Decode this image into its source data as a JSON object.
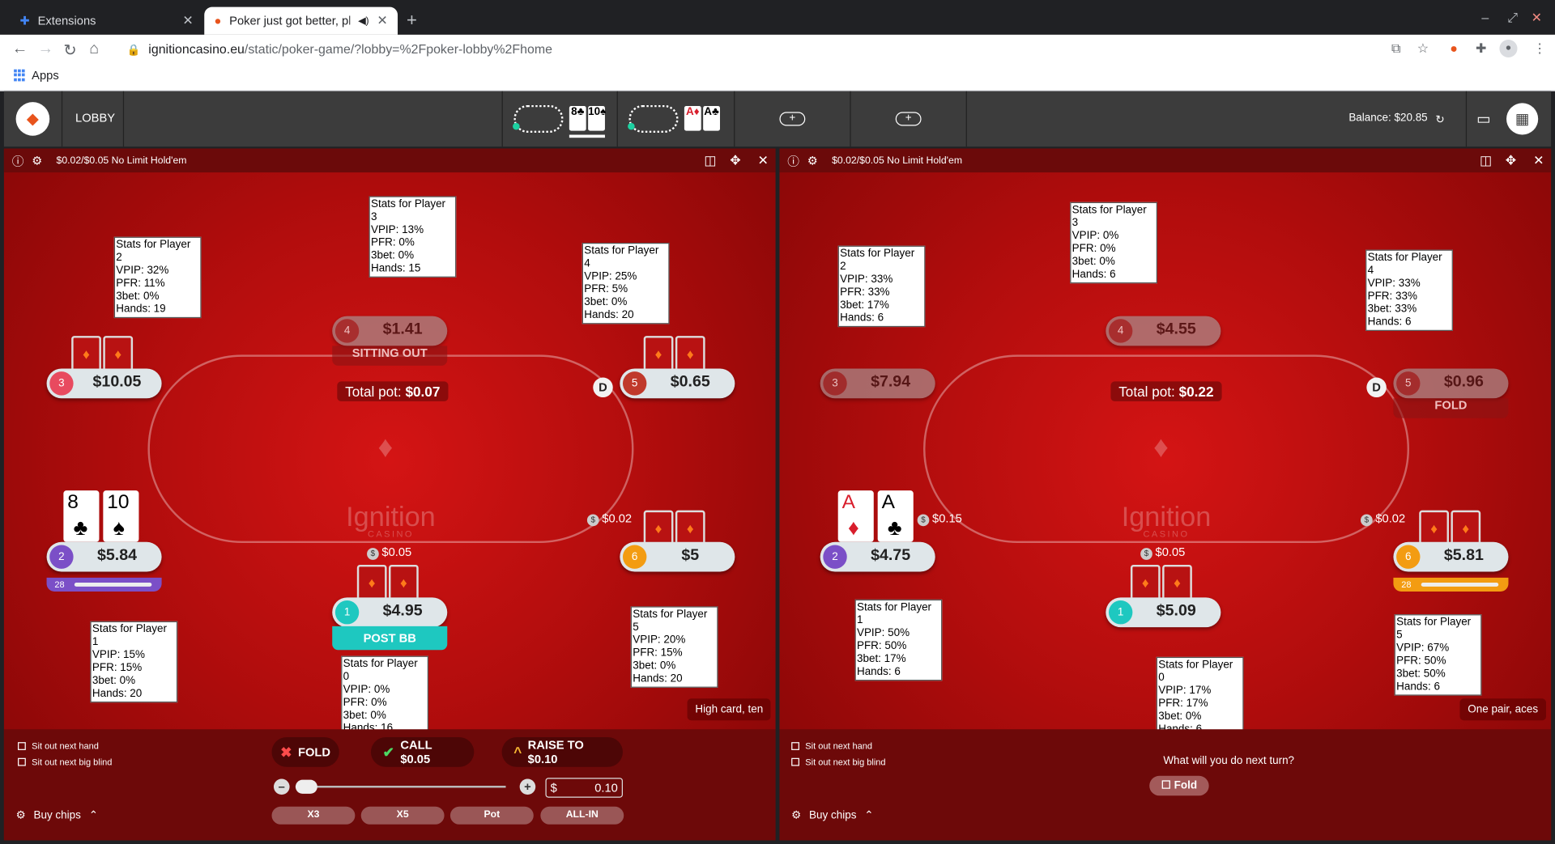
{
  "browser": {
    "tabs": [
      {
        "title": "Extensions",
        "icon": "puzzle-icon"
      },
      {
        "title": "Poker just got better, pla",
        "icon": "ignition-favicon"
      }
    ],
    "url_host": "ignitioncasino.eu",
    "url_path": "/static/poker-game/?lobby=%2Fpoker-lobby%2Fhome",
    "bookmarks_label": "Apps"
  },
  "header": {
    "lobby_label": "LOBBY",
    "mini1_cards": [
      "8♣",
      "10♠"
    ],
    "mini2_cards": [
      "A♦",
      "A♣"
    ],
    "balance": "Balance: $20.85"
  },
  "table_left": {
    "title": "$0.02/$0.05 No Limit Hold'em",
    "total_pot_label": "Total pot:",
    "total_pot": "$0.07",
    "seats": [
      {
        "num": "4",
        "amount": "$1.41",
        "state": "SITTING OUT"
      },
      {
        "num": "3",
        "amount": "$10.05"
      },
      {
        "num": "5",
        "amount": "$0.65"
      },
      {
        "num": "2",
        "amount": "$5.84",
        "timer": "28"
      },
      {
        "num": "6",
        "amount": "$5"
      },
      {
        "num": "1",
        "amount": "$4.95",
        "state": "POST BB"
      }
    ],
    "bets": [
      "$0.02",
      "$0.05"
    ],
    "hero_cards": [
      {
        "rank": "8",
        "suit": "♣"
      },
      {
        "rank": "10",
        "suit": "♠"
      }
    ],
    "stats": [
      {
        "title": "Stats for Player 2",
        "vpip": "VPIP: 32%",
        "pfr": "PFR: 11%",
        "bet3": "3bet: 0%",
        "hands": "Hands: 19"
      },
      {
        "title": "Stats for Player 3",
        "vpip": "VPIP: 13%",
        "pfr": "PFR: 0%",
        "bet3": "3bet: 0%",
        "hands": "Hands: 15"
      },
      {
        "title": "Stats for Player 4",
        "vpip": "VPIP: 25%",
        "pfr": "PFR: 5%",
        "bet3": "3bet: 0%",
        "hands": "Hands: 20"
      },
      {
        "title": "Stats for Player 1",
        "vpip": "VPIP: 15%",
        "pfr": "PFR: 15%",
        "bet3": "3bet: 0%",
        "hands": "Hands: 20"
      },
      {
        "title": "Stats for Player 5",
        "vpip": "VPIP: 20%",
        "pfr": "PFR: 15%",
        "bet3": "3bet: 0%",
        "hands": "Hands: 20"
      },
      {
        "title": "Stats for Player 0",
        "vpip": "VPIP: 0%",
        "pfr": "PFR: 0%",
        "bet3": "3bet: 0%",
        "hands": "Hands: 16"
      }
    ],
    "hand_label": "High card, ten",
    "sit_out_next_hand": "Sit out next hand",
    "sit_out_next_bb": "Sit out next big blind",
    "fold": "FOLD",
    "call": "CALL $0.05",
    "raise": "RAISE TO $0.10",
    "bet_currency": "$",
    "bet_value": "0.10",
    "bet_fraction": 0.0,
    "presets": [
      "X3",
      "X5",
      "Pot",
      "ALL-IN"
    ],
    "buy_chips": "Buy chips"
  },
  "table_right": {
    "title": "$0.02/$0.05 No Limit Hold'em",
    "total_pot_label": "Total pot:",
    "total_pot": "$0.22",
    "seats": [
      {
        "num": "4",
        "amount": "$4.55"
      },
      {
        "num": "3",
        "amount": "$7.94"
      },
      {
        "num": "5",
        "amount": "$0.96",
        "state": "FOLD"
      },
      {
        "num": "2",
        "amount": "$4.75"
      },
      {
        "num": "6",
        "amount": "$5.81",
        "timer": "28"
      },
      {
        "num": "1",
        "amount": "$5.09"
      }
    ],
    "bets": [
      "$0.15",
      "$0.02",
      "$0.05"
    ],
    "hero_cards": [
      {
        "rank": "A",
        "suit": "♦"
      },
      {
        "rank": "A",
        "suit": "♣"
      }
    ],
    "stats": [
      {
        "title": "Stats for Player 2",
        "vpip": "VPIP: 33%",
        "pfr": "PFR: 33%",
        "bet3": "3bet: 17%",
        "hands": "Hands: 6"
      },
      {
        "title": "Stats for Player 3",
        "vpip": "VPIP: 0%",
        "pfr": "PFR: 0%",
        "bet3": "3bet: 0%",
        "hands": "Hands: 6"
      },
      {
        "title": "Stats for Player 4",
        "vpip": "VPIP: 33%",
        "pfr": "PFR: 33%",
        "bet3": "3bet: 33%",
        "hands": "Hands: 6"
      },
      {
        "title": "Stats for Player 1",
        "vpip": "VPIP: 50%",
        "pfr": "PFR: 50%",
        "bet3": "3bet: 17%",
        "hands": "Hands: 6"
      },
      {
        "title": "Stats for Player 5",
        "vpip": "VPIP: 67%",
        "pfr": "PFR: 50%",
        "bet3": "3bet: 50%",
        "hands": "Hands: 6"
      },
      {
        "title": "Stats for Player 0",
        "vpip": "VPIP: 17%",
        "pfr": "PFR: 17%",
        "bet3": "3bet: 0%",
        "hands": "Hands: 6"
      }
    ],
    "hand_label": "One pair, aces",
    "sit_out_next_hand": "Sit out next hand",
    "sit_out_next_bb": "Sit out next big blind",
    "next_turn": "What will you do next turn?",
    "fold": "Fold",
    "buy_chips": "Buy chips"
  },
  "colors": {
    "seat1": "#1ec8c0",
    "seat2": "#7b4fc7",
    "seat3": "#e84a5f",
    "seat4": "#a03838",
    "seat5": "#c0392b",
    "seat6": "#f39c12"
  }
}
